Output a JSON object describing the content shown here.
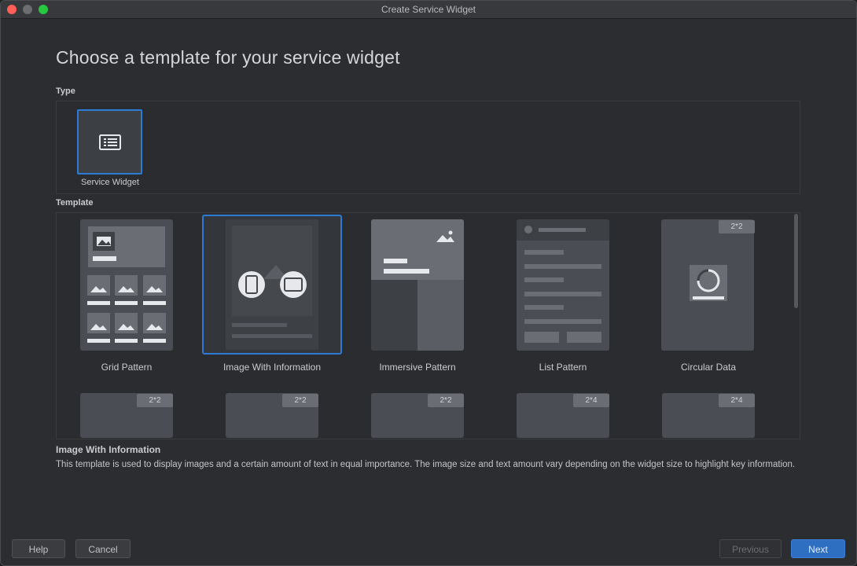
{
  "window": {
    "title": "Create Service Widget"
  },
  "heading": "Choose a template for your service widget",
  "type_section": {
    "label": "Type",
    "items": [
      {
        "label": "Service Widget",
        "icon": "list-card-icon",
        "selected": true
      }
    ]
  },
  "template_section": {
    "label": "Template",
    "items": [
      {
        "label": "Grid Pattern"
      },
      {
        "label": "Image With Information",
        "selected": true
      },
      {
        "label": "Immersive Pattern"
      },
      {
        "label": "List Pattern"
      },
      {
        "label": "Circular Data",
        "badge": "2*2"
      }
    ],
    "row2_badges": [
      "2*2",
      "2*2",
      "2*2",
      "2*4",
      "2*4"
    ]
  },
  "description": {
    "title": "Image With Information",
    "text": "This template is used to display images and a certain amount of text in equal importance. The image size and text amount vary depending on the widget size to highlight key information."
  },
  "buttons": {
    "help": "Help",
    "cancel": "Cancel",
    "previous": "Previous",
    "next": "Next"
  },
  "colors": {
    "accent": "#2e7bd6",
    "background": "#2b2d30",
    "card": "#4a4d53"
  }
}
